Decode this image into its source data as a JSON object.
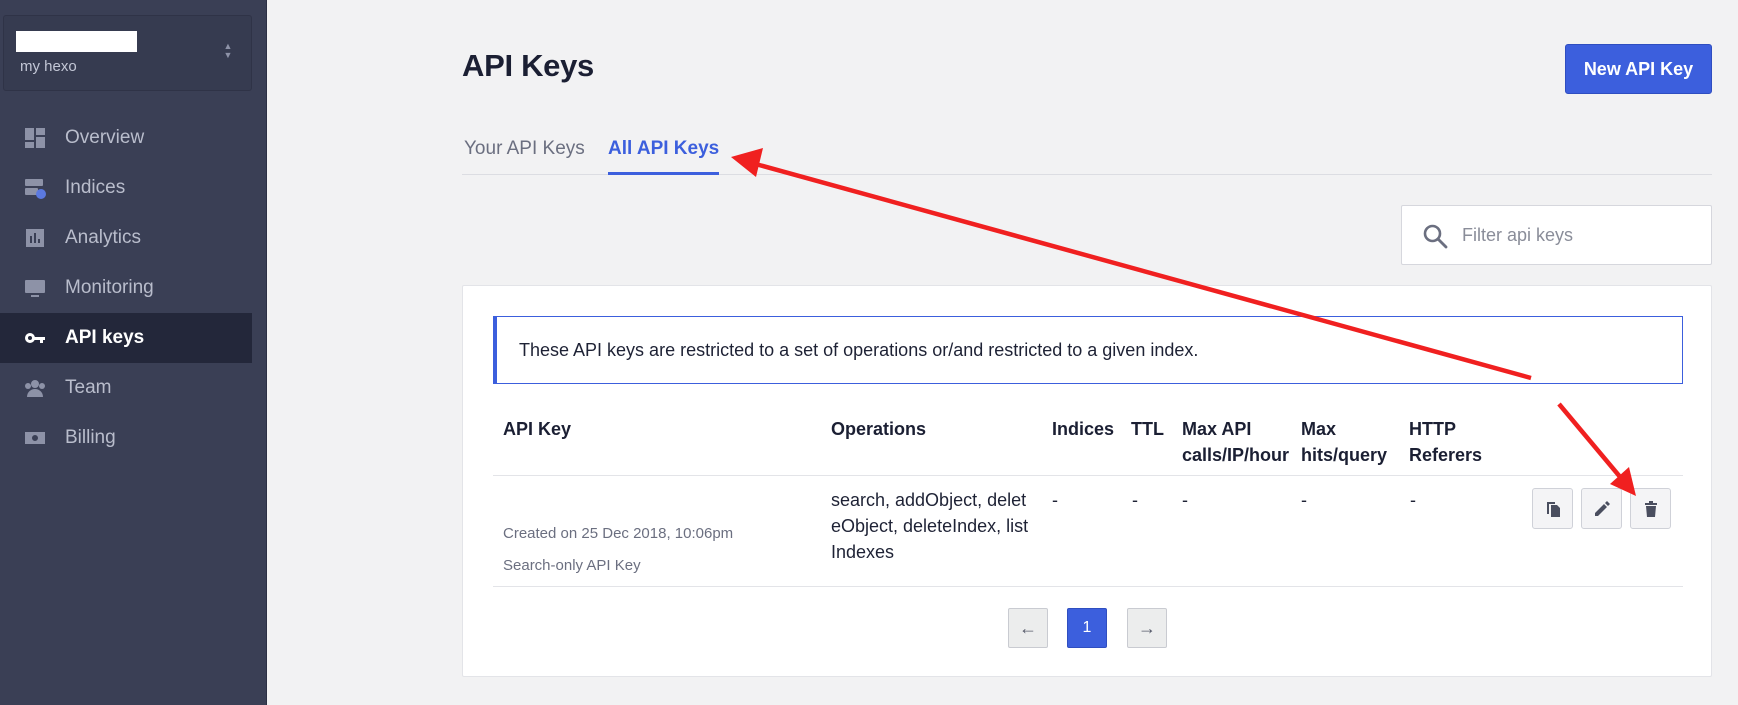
{
  "sidebar": {
    "app_subtitle": "my hexo",
    "items": [
      {
        "label": "Overview",
        "icon": "dashboard-icon"
      },
      {
        "label": "Indices",
        "icon": "indices-icon"
      },
      {
        "label": "Analytics",
        "icon": "analytics-icon"
      },
      {
        "label": "Monitoring",
        "icon": "monitor-icon"
      },
      {
        "label": "API keys",
        "icon": "key-icon",
        "active": true
      },
      {
        "label": "Team",
        "icon": "team-icon"
      },
      {
        "label": "Billing",
        "icon": "billing-icon"
      }
    ]
  },
  "header": {
    "title": "API Keys",
    "new_key_label": "New API Key"
  },
  "tabs": [
    {
      "label": "Your API Keys",
      "active": false
    },
    {
      "label": "All API Keys",
      "active": true
    }
  ],
  "filter": {
    "placeholder": "Filter api keys"
  },
  "notice": "These API keys are restricted to a set of operations or/and restricted to a given index.",
  "table": {
    "headers": {
      "api_key": "API Key",
      "operations": "Operations",
      "indices": "Indices",
      "ttl": "TTL",
      "max_api_l1": "Max API",
      "max_api_l2": "calls/IP/hour",
      "max_hits_l1": "Max",
      "max_hits_l2": "hits/query",
      "referers_l1": "HTTP",
      "referers_l2": "Referers"
    },
    "rows": [
      {
        "created": "Created on 25 Dec 2018, 10:06pm",
        "description": "Search-only API Key",
        "operations_l1": "search, addObject, delet",
        "operations_l2": "eObject, deleteIndex, list",
        "operations_l3": "Indexes",
        "indices": "-",
        "ttl": "-",
        "max_api": "-",
        "max_hits": "-",
        "referers": "-",
        "actions": [
          "copy-icon",
          "edit-icon",
          "delete-icon"
        ]
      }
    ]
  },
  "pagination": {
    "prev": "←",
    "page": "1",
    "next": "→"
  },
  "colors": {
    "accent": "#3c5fdd",
    "sidebar": "#3a3f55",
    "annotation_arrow": "#f02020"
  }
}
